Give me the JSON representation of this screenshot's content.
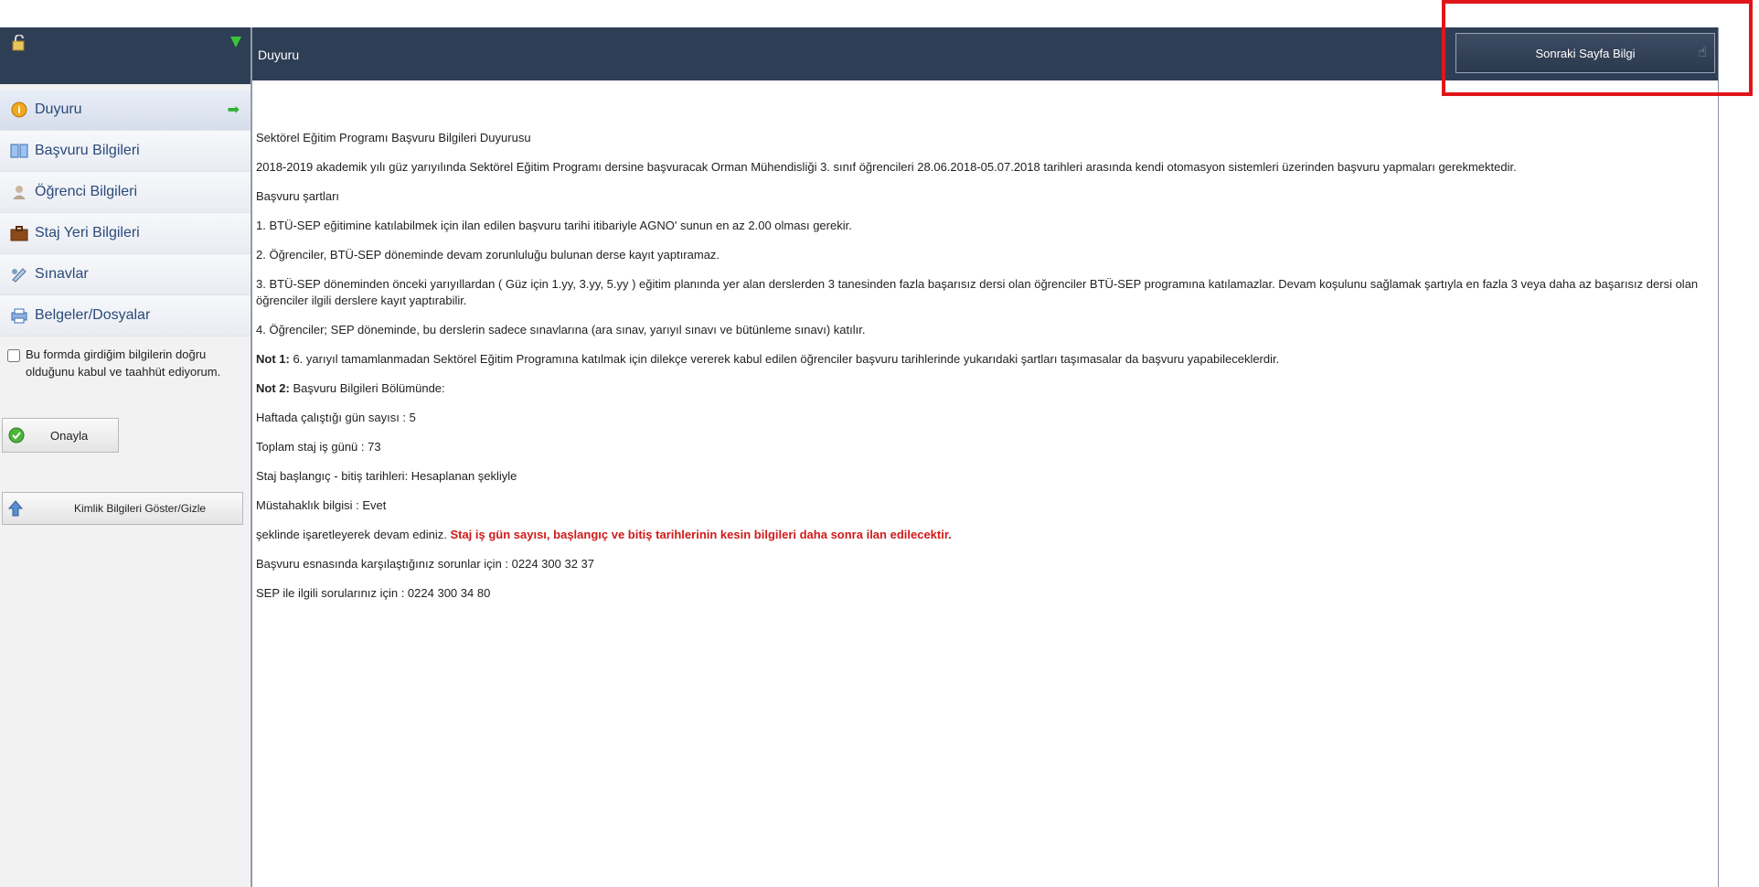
{
  "sidebar": {
    "items": [
      {
        "label": "Duyuru",
        "icon": "info-icon",
        "active": true
      },
      {
        "label": "Başvuru Bilgileri",
        "icon": "book-icon",
        "active": false
      },
      {
        "label": "Öğrenci Bilgileri",
        "icon": "user-icon",
        "active": false
      },
      {
        "label": "Staj Yeri Bilgileri",
        "icon": "briefcase-icon",
        "active": false
      },
      {
        "label": "Sınavlar",
        "icon": "exam-icon",
        "active": false
      },
      {
        "label": "Belgeler/Dosyalar",
        "icon": "printer-icon",
        "active": false
      }
    ],
    "consent_text": "Bu formda girdiğim bilgilerin doğru olduğunu kabul ve taahhüt ediyorum.",
    "approve_label": "Onayla",
    "identity_label": "Kimlik Bilgileri Göster/Gizle"
  },
  "main": {
    "title": "Duyuru",
    "next_button": "Sonraki Sayfa Bilgi",
    "content": {
      "heading": "Sektörel Eğitim Programı Başvuru Bilgileri Duyurusu",
      "intro": "2018-2019 akademik yılı güz yarıyılında Sektörel Eğitim Programı dersine başvuracak Orman Mühendisliği 3. sınıf öğrencileri 28.06.2018-05.07.2018 tarihleri arasında kendi otomasyon sistemleri üzerinden başvuru yapmaları gerekmektedir.",
      "conditions_title": "Başvuru şartları",
      "cond1": "1. BTÜ-SEP eğitimine katılabilmek için ilan edilen başvuru tarihi itibariyle AGNO' sunun en az 2.00 olması gerekir.",
      "cond2": "2. Öğrenciler, BTÜ-SEP döneminde devam zorunluluğu bulunan derse kayıt yaptıramaz.",
      "cond3": "3. BTÜ-SEP döneminden önceki yarıyıllardan ( Güz için 1.yy, 3.yy, 5.yy ) eğitim planında yer alan derslerden 3 tanesinden fazla başarısız dersi olan öğrenciler BTÜ-SEP programına katılamazlar. Devam koşulunu sağlamak şartıyla en fazla 3 veya daha az başarısız dersi olan öğrenciler ilgili derslere kayıt yaptırabilir.",
      "cond4": "4. Öğrenciler; SEP döneminde, bu derslerin sadece sınavlarına (ara sınav, yarıyıl sınavı ve bütünleme sınavı) katılır.",
      "note1_label": "Not 1:",
      "note1_text": " 6. yarıyıl tamamlanmadan  Sektörel Eğitim Programına katılmak için dilekçe vererek kabul edilen öğrenciler başvuru tarihlerinde  yukarıdaki şartları taşımasalar da başvuru yapabileceklerdir.",
      "note2_label": "Not 2:",
      "note2_text": " Başvuru Bilgileri Bölümünde:",
      "days_per_week": "Haftada çalıştığı gün sayısı : 5",
      "total_days": "Toplam staj iş günü : 73",
      "dates": "Staj başlangıç - bitiş tarihleri: Hesaplanan şekliyle",
      "eligibility": "Müstahaklık bilgisi : Evet",
      "continue_text": "şeklinde işaretleyerek devam ediniz. ",
      "warning_text": "Staj iş gün sayısı, başlangıç ve bitiş tarihlerinin kesin bilgileri daha sonra ilan edilecektir.",
      "contact1": "Başvuru esnasında karşılaştığınız sorunlar için : 0224 300 32 37",
      "contact2": "SEP ile ilgili sorularınız için : 0224 300 34 80"
    }
  },
  "colors": {
    "header_bg": "#2e3e55",
    "highlight": "#e0151b",
    "warning": "#d11a1a",
    "nav_text": "#2a4a7a"
  }
}
